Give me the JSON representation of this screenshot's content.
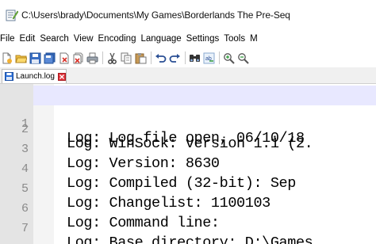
{
  "window": {
    "title": "C:\\Users\\brady\\Documents\\My Games\\Borderlands The Pre-Seq"
  },
  "menu": {
    "items": [
      "File",
      "Edit",
      "Search",
      "View",
      "Encoding",
      "Language",
      "Settings",
      "Tools",
      "M"
    ]
  },
  "toolbar": {
    "buttons": [
      "new-file-icon",
      "open-file-icon",
      "save-icon",
      "save-all-icon",
      "close-icon",
      "close-all-icon",
      "print-icon",
      "cut-icon",
      "copy-icon",
      "paste-icon",
      "undo-icon",
      "redo-icon",
      "find-icon",
      "replace-icon",
      "zoom-in-icon",
      "zoom-out-icon"
    ]
  },
  "tab": {
    "label": "Launch.log"
  },
  "editor": {
    "lines": [
      {
        "number": "1",
        "text": "Log: Log file open, 06/10/18"
      },
      {
        "number": "2",
        "text": "Log: WinSock: version 1.1 (2."
      },
      {
        "number": "3",
        "text": "Log: Version: 8630"
      },
      {
        "number": "4",
        "text": "Log: Compiled (32-bit): Sep"
      },
      {
        "number": "5",
        "text": "Log: Changelist: 1100103"
      },
      {
        "number": "6",
        "text": "Log: Command line:"
      },
      {
        "number": "7",
        "text": "Log: Base directory: D:\\Games"
      }
    ]
  },
  "colors": {
    "gutter": "#e4e4e4",
    "current_line": "#e8e8ff",
    "tab_save_icon": "#2b6fd8",
    "tab_close": "#e0323a"
  }
}
